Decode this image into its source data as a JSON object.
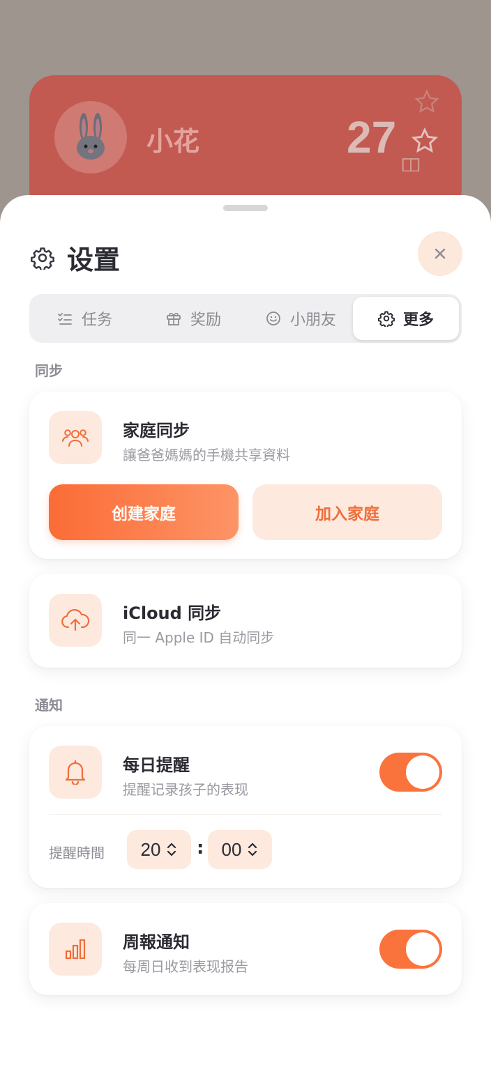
{
  "background_card": {
    "name": "小花",
    "score": "27"
  },
  "sheet": {
    "title": "设置",
    "tabs": [
      {
        "label": "任务",
        "icon": "checklist-icon",
        "active": false
      },
      {
        "label": "奖励",
        "icon": "gift-icon",
        "active": false
      },
      {
        "label": "小朋友",
        "icon": "smiley-icon",
        "active": false
      },
      {
        "label": "更多",
        "icon": "gear-icon",
        "active": true
      }
    ],
    "sections": {
      "sync_label": "同步",
      "notify_label": "通知"
    },
    "family_sync": {
      "title": "家庭同步",
      "subtitle": "讓爸爸媽媽的手機共享資料",
      "create_label": "创建家庭",
      "join_label": "加入家庭"
    },
    "icloud_sync": {
      "title": "iCloud 同步",
      "subtitle": "同一 Apple ID 自动同步"
    },
    "daily_reminder": {
      "title": "每日提醒",
      "subtitle": "提醒记录孩子的表现",
      "enabled": true,
      "time_label": "提醒時間",
      "hour": "20",
      "minute": "00",
      "colon": ":"
    },
    "weekly_report": {
      "title": "周報通知",
      "subtitle": "每周日收到表现报告",
      "enabled": true
    }
  },
  "colors": {
    "accent": "#fb6c36",
    "accent_soft": "#fde9de",
    "title": "#2b2b33",
    "muted": "#9a9aa2"
  }
}
